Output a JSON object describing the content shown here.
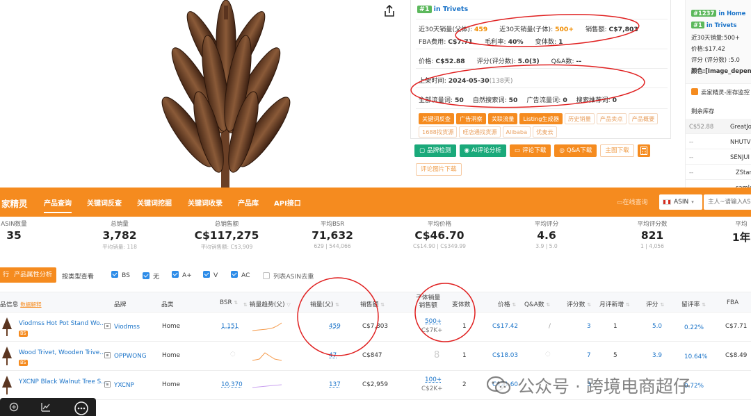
{
  "product_panel": {
    "rank_badge": "#1",
    "rank_category": "in Trivets",
    "row1": {
      "l1": "近30天销量(父体):",
      "v1": "459",
      "l2": "近30天销量(子体):",
      "v2": "500+",
      "l3": "销售额:",
      "v3": "C$7,803"
    },
    "row2": {
      "l1": "FBA费用:",
      "v1": "C$7.71",
      "l2": "毛利率:",
      "v2": "40%",
      "l3": "变体数:",
      "v3": "1"
    },
    "row3": {
      "l1": "价格:",
      "v1": "C$52.88",
      "l2": "评分(评分数):",
      "v2": "5.0(3)",
      "l3": "Q&A数:",
      "v3": "--"
    },
    "row4": {
      "l1": "上架时间:",
      "v1": "2024-05-30",
      "v1b": "(138天)"
    },
    "row5": {
      "l1": "全部流量词:",
      "v1": "50",
      "l2": "自然搜索词:",
      "v2": "50",
      "l3": "广告流量词:",
      "v3": "0",
      "l4": "搜索推荐词:",
      "v4": "0"
    },
    "tags": [
      {
        "label": "关键词反查",
        "style": "solid"
      },
      {
        "label": "广告洞察",
        "style": "solid"
      },
      {
        "label": "关联流量",
        "style": "solid"
      },
      {
        "label": "Listing生成器",
        "style": "solid"
      },
      {
        "label": "历史销量",
        "style": "light"
      },
      {
        "label": "产品卖点",
        "style": "light"
      },
      {
        "label": "产品概要",
        "style": "light"
      },
      {
        "label": "1688找货源",
        "style": "light"
      },
      {
        "label": "旺店通找货源",
        "style": "light"
      },
      {
        "label": "Alibaba",
        "style": "light"
      },
      {
        "label": "优麦云",
        "style": "light"
      }
    ],
    "buttons": {
      "brand_check": "品牌检测",
      "ai_review": "AI评论分析",
      "review_download": "评论下载",
      "qa_download": "Q&A下载",
      "main_image_download": "主图下载",
      "review_image_download": "评论图片下载"
    }
  },
  "side_panel": {
    "rank1_badge": "#1237",
    "rank1_cat": "in Home",
    "rank2_badge": "#1",
    "rank2_cat": "in Trivets",
    "sales": "近30天销量:500+",
    "price": "价格:$17.42",
    "rating": "评分 (评分数) :5.0",
    "color": "颜色:[Image_depende",
    "section_title": "卖家精灵-库存监控",
    "inventory_label": "剩余库存",
    "inventory_rows": [
      {
        "price": "C$52.88",
        "seller": "GreatJo"
      },
      {
        "price": "--",
        "seller": "NHUTV"
      },
      {
        "price": "--",
        "seller": "SENJUI"
      },
      {
        "price": "--",
        "seller": "ZStar"
      },
      {
        "price": "--",
        "seller": "samlo"
      }
    ]
  },
  "toolbar": {
    "logo": "家精灵",
    "nav": [
      "产品查询",
      "关键词反查",
      "关键词挖掘",
      "关键词收录",
      "产品库",
      "API接口"
    ],
    "online_query": "在线查询",
    "country": "ASIN",
    "search_placeholder": "主人~请输入ASIN"
  },
  "stats": [
    {
      "label": "ASIN数量",
      "value": "35",
      "sub": ""
    },
    {
      "label": "总销量",
      "value": "3,782",
      "sub": "平均销量: 118"
    },
    {
      "label": "总销售额",
      "value": "C$117,275",
      "sub": "平均销售额: C$3,909"
    },
    {
      "label": "平均BSR",
      "value": "71,632",
      "sub": "629 | 544,066"
    },
    {
      "label": "平均价格",
      "value": "C$46.70",
      "sub": "C$14.90 | C$349.99"
    },
    {
      "label": "平均评分",
      "value": "4.6",
      "sub": "3.9 | 5.0"
    },
    {
      "label": "平均评分数",
      "value": "821",
      "sub": "1 | 4,056"
    },
    {
      "label": "平均",
      "value": "1年",
      "sub": ""
    }
  ],
  "filters": {
    "btn_left": "行",
    "btn_attr": "产品属性分析",
    "by_type": "按类型查看",
    "checks": [
      {
        "label": "BS",
        "on": true
      },
      {
        "label": "无",
        "on": true
      },
      {
        "label": "A+",
        "on": true
      },
      {
        "label": "V",
        "on": true
      },
      {
        "label": "AC",
        "on": true
      },
      {
        "label": "列表ASIN去重",
        "on": false
      }
    ]
  },
  "table": {
    "headers": {
      "product": "品信息",
      "product_link": "数据解释",
      "brand": "品牌",
      "category": "品类",
      "bsr": "BSR",
      "trend": "销量趋势(父)",
      "sales": "销量(父)",
      "revenue": "销售额",
      "child_sales_1": "子体销量",
      "child_sales_2": "销售额",
      "variants": "变体数",
      "price": "价格",
      "qa": "Q&A数",
      "rating_count": "评分数",
      "monthly_new": "月评新增",
      "rating": "评分",
      "retention": "留评率",
      "fba": "FBA"
    },
    "rows": [
      {
        "title": "Viodmss Hot Pot Stand Wo...",
        "bs": true,
        "brand": "Viodmss",
        "category": "Home",
        "bsr": "1,151",
        "sales": "459",
        "revenue": "C$7,803",
        "child_sales": "500+",
        "child_revenue": "C$7K+",
        "variants": "1",
        "price": "C$17.42",
        "qa": "/",
        "rating_count": "3",
        "monthly_new": "1",
        "rating": "5.0",
        "retention": "0.22%",
        "fba": "C$7.71"
      },
      {
        "title": "Wood Trivet, Wooden Trive...",
        "bs": true,
        "brand": "OPPWONG",
        "category": "Home",
        "bsr": "",
        "sales": "47",
        "revenue": "C$847",
        "child_sales": "",
        "child_revenue": "",
        "variants": "1",
        "price": "C$18.03",
        "qa": "",
        "rating_count": "7",
        "monthly_new": "5",
        "rating": "3.9",
        "retention": "10.64%",
        "fba": "C$8.49"
      },
      {
        "title": "YXCNP Black Walnut Tree S...",
        "bs": false,
        "brand": "YXCNP",
        "category": "Home",
        "bsr": "10,370",
        "sales": "137",
        "revenue": "C$2,959",
        "child_sales": "100+",
        "child_revenue": "C$2K+",
        "variants": "2",
        "price": "C$21.60",
        "qa": "",
        "rating_count": "3",
        "monthly_new": "",
        "rating": "",
        "retention": "0.72%",
        "fba": ""
      }
    ]
  },
  "watermark": {
    "text": "公众号 · 跨境电商超仔"
  },
  "colors": {
    "accent": "#f58b1f",
    "link": "#1a73c8",
    "annotation": "#e02020",
    "badge_green": "#5cb85c"
  }
}
